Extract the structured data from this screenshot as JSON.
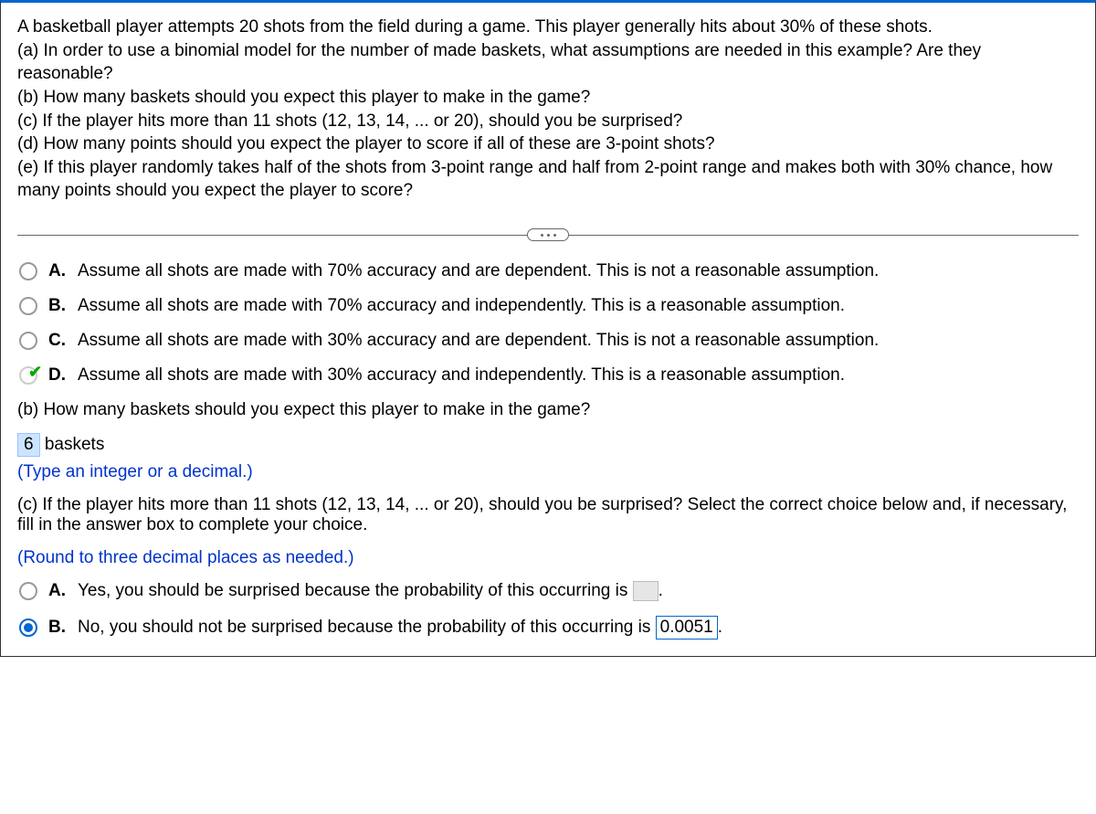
{
  "question": {
    "intro": "A basketball player attempts 20 shots from the field during a game. This player generally hits about 30% of these shots.",
    "a": "(a) In order to use a binomial model for the number of made baskets, what assumptions are needed in this example? Are they reasonable?",
    "b": "(b) How many baskets should you expect this player to make in the game?",
    "c": "(c) If the player hits more than 11 shots (12, 13, 14, ... or 20), should you be surprised?",
    "d": "(d) How many points should you expect the player to score if all of these are 3-point shots?",
    "e": "(e) If this player randomly takes half of the shots from 3-point range and half from 2-point range and makes both with 30% chance, how many points should you expect the player to score?"
  },
  "partA": {
    "choices": [
      {
        "letter": "A.",
        "text": "Assume all shots are made with 70% accuracy and are dependent. This is not a reasonable assumption."
      },
      {
        "letter": "B.",
        "text": "Assume all shots are made with 70% accuracy and independently. This is a reasonable assumption."
      },
      {
        "letter": "C.",
        "text": "Assume all shots are made with 30% accuracy and are dependent. This is not a reasonable assumption."
      },
      {
        "letter": "D.",
        "text": "Assume all shots are made with 30% accuracy and independently. This is a reasonable assumption."
      }
    ],
    "correctIndex": 3
  },
  "partB": {
    "prompt": "(b) How many baskets should you expect this player to make in the game?",
    "answer": "6",
    "unit": " baskets",
    "hint": "(Type an integer or a decimal.)"
  },
  "partC": {
    "prompt": "(c) If the player hits more than 11 shots (12, 13, 14, ... or 20), should you be surprised? Select the correct choice below and, if necessary, fill in the answer box to complete your choice.",
    "hint": "(Round to three decimal places as needed.)",
    "choices": [
      {
        "letter": "A.",
        "textBefore": "Yes, you should be surprised because the probability of this occurring is ",
        "value": "",
        "textAfter": "."
      },
      {
        "letter": "B.",
        "textBefore": "No, you should not be surprised because the probability of this occurring is ",
        "value": "0.0051",
        "textAfter": "."
      }
    ],
    "selectedIndex": 1
  }
}
